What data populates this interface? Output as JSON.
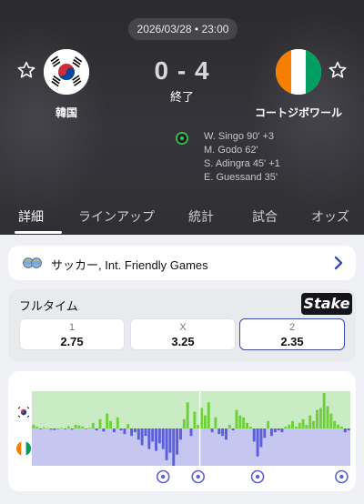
{
  "match": {
    "datetime": "2026/03/28 • 23:00",
    "score": "0 - 4",
    "status": "終了",
    "home": {
      "name": "韓国",
      "flag": "south-korea-flag"
    },
    "away": {
      "name": "コートジボワール",
      "flag": "ivory-coast-flag"
    },
    "scorers": [
      "W. Singo 90' +3",
      "M. Godo 62'",
      "S. Adingra 45' +1",
      "E. Guessand 35'"
    ]
  },
  "tabs": [
    {
      "label": "詳細",
      "active": true
    },
    {
      "label": "ラインアップ",
      "active": false
    },
    {
      "label": "統計",
      "active": false
    },
    {
      "label": "試合",
      "active": false
    },
    {
      "label": "オッズ",
      "active": false
    }
  ],
  "league": {
    "text": "サッカー, Int. Friendly Games"
  },
  "odds": {
    "title": "フルタイム",
    "bookmaker": "Stake",
    "options": [
      {
        "label": "1",
        "value": "2.75",
        "selected": false
      },
      {
        "label": "X",
        "value": "3.25",
        "selected": false
      },
      {
        "label": "2",
        "value": "2.35",
        "selected": true
      }
    ]
  },
  "colors": {
    "home_momentum": "#6fcf3c",
    "away_momentum": "#5b5fd8",
    "home_bg": "#c9ecc4",
    "away_bg": "#c5c7f1",
    "selected_border": "#3b4ba8"
  },
  "chart_data": {
    "type": "bar",
    "title": "",
    "xlabel": "",
    "ylabel": "",
    "ylim": [
      -1,
      1
    ],
    "halftime_split_after_index": 47,
    "goal_markers_index": [
      37,
      47,
      64,
      88
    ],
    "series": [
      {
        "values": [
          0.1,
          0.05,
          -0.02,
          0.03,
          0.01,
          -0.03,
          -0.04,
          -0.01,
          0.02,
          -0.02,
          0.06,
          -0.03,
          0.1,
          0.08,
          0.05,
          -0.01,
          0.02,
          0.15,
          -0.05,
          0.25,
          -0.08,
          0.4,
          0.2,
          -0.1,
          0.3,
          -0.05,
          -0.15,
          0.12,
          -0.2,
          -0.1,
          -0.3,
          -0.45,
          -0.2,
          -0.55,
          -0.35,
          -0.6,
          -0.4,
          -0.55,
          -0.85,
          -0.65,
          -1.0,
          -0.7,
          -0.3,
          0.25,
          0.7,
          -0.2,
          0.45,
          0.1,
          0.55,
          0.35,
          0.7,
          -0.1,
          0.3,
          -0.15,
          -0.2,
          -0.3,
          0.1,
          -0.05,
          0.5,
          0.35,
          0.3,
          0.15,
          0.05,
          -0.35,
          -0.75,
          -0.5,
          -0.25,
          0.2,
          -0.2,
          -0.1,
          -0.05,
          -0.1,
          0.05,
          0.1,
          0.2,
          0.05,
          0.15,
          0.25,
          0.1,
          0.35,
          0.2,
          0.5,
          0.55,
          0.95,
          0.6,
          0.4,
          0.2,
          0.1,
          0.05,
          -0.1,
          -0.05
        ]
      }
    ]
  }
}
